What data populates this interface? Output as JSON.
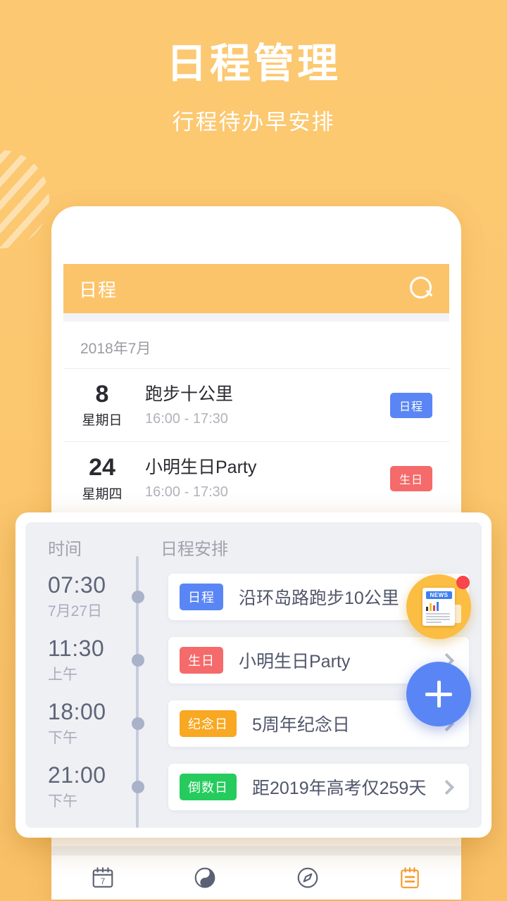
{
  "hero": {
    "title": "日程管理",
    "subtitle": "行程待办早安排"
  },
  "colors": {
    "background": "#fcc871",
    "appbar": "#fcc46a",
    "tag_blue": "#5a86f5",
    "tag_red": "#f56a6a",
    "tag_orange": "#f8a823",
    "tag_green": "#25cc5d",
    "fab": "#5a86f5",
    "news_button": "#fbbd42",
    "badge_dot": "#f8464a"
  },
  "phone": {
    "appbar": {
      "title": "日程",
      "search_icon": "search-icon"
    },
    "month_label": "2018年7月",
    "schedule_rows": [
      {
        "day": "8",
        "weekday": "星期日",
        "title": "跑步十公里",
        "time": "16:00 - 17:30",
        "tag": "日程",
        "tag_color": "blue"
      },
      {
        "day": "24",
        "weekday": "星期四",
        "title": "小明生日Party",
        "time": "16:00 - 17:30",
        "tag": "生日",
        "tag_color": "red"
      },
      {
        "day": "",
        "weekday": "",
        "title": "",
        "time": "",
        "tag": "",
        "tag_color": "orange"
      }
    ],
    "bottom_nav": [
      {
        "icon": "calendar-icon",
        "label": "7",
        "active": false
      },
      {
        "icon": "yin-yang-icon",
        "label": "",
        "active": false
      },
      {
        "icon": "compass-icon",
        "label": "",
        "active": false
      },
      {
        "icon": "clipboard-icon",
        "label": "",
        "active": true
      }
    ]
  },
  "timeline": {
    "header_time": "时间",
    "header_schedule": "日程安排",
    "rows": [
      {
        "time": "07:30",
        "period": "7月27日",
        "tag": "日程",
        "tag_color": "blue",
        "title": "沿环岛路跑步10公里"
      },
      {
        "time": "11:30",
        "period": "上午",
        "tag": "生日",
        "tag_color": "red",
        "title": "小明生日Party"
      },
      {
        "time": "18:00",
        "period": "下午",
        "tag": "纪念日",
        "tag_color": "orange",
        "title": "5周年纪念日"
      },
      {
        "time": "21:00",
        "period": "下午",
        "tag": "倒数日",
        "tag_color": "green",
        "title": "距2019年高考仅259天"
      }
    ]
  },
  "floating": {
    "news_label": "NEWS",
    "news_icon": "news-icon",
    "fab_icon": "plus-icon"
  }
}
